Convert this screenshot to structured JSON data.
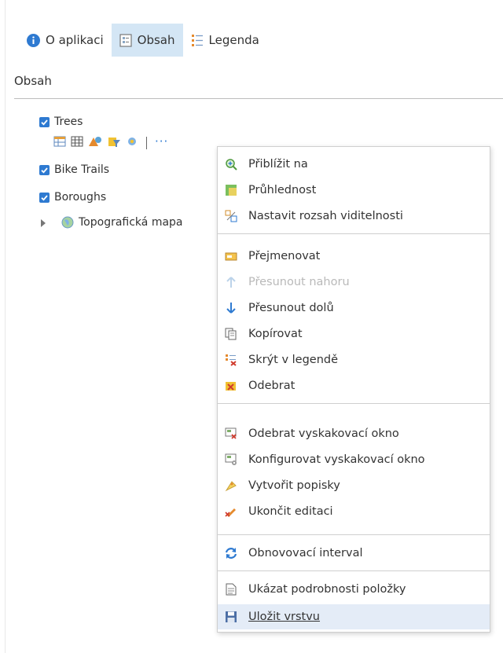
{
  "tabs": [
    {
      "label": "O aplikaci",
      "icon": "info-icon"
    },
    {
      "label": "Obsah",
      "icon": "contents-icon",
      "active": true
    },
    {
      "label": "Legenda",
      "icon": "legend-icon"
    }
  ],
  "section_title": "Obsah",
  "layers": [
    {
      "name": "Trees",
      "checked": true
    },
    {
      "name": "Bike Trails",
      "checked": true
    },
    {
      "name": "Boroughs",
      "checked": true
    },
    {
      "name": "Topografická mapa",
      "icon": "basemap-globe-icon"
    }
  ],
  "layer_tools": [
    "table-icon",
    "attribute-grid-icon",
    "style-icon",
    "filter-icon",
    "analysis-icon",
    "more-options-icon"
  ],
  "layer_tools_more": "···",
  "menu": {
    "items": [
      {
        "label": "Přiblížit na",
        "icon": "zoom-to-icon"
      },
      {
        "label": "Průhlednost",
        "icon": "transparency-icon"
      },
      {
        "label": "Nastavit rozsah viditelnosti",
        "icon": "visibility-range-icon"
      },
      {
        "label": "Přejmenovat",
        "icon": "rename-icon"
      },
      {
        "label": "Přesunout nahoru",
        "icon": "arrow-up-icon",
        "disabled": true
      },
      {
        "label": "Přesunout dolů",
        "icon": "arrow-down-icon"
      },
      {
        "label": "Kopírovat",
        "icon": "copy-icon"
      },
      {
        "label": "Skrýt v legendě",
        "icon": "hide-in-legend-icon"
      },
      {
        "label": "Odebrat",
        "icon": "remove-icon"
      },
      {
        "label": "Odebrat vyskakovací okno",
        "icon": "remove-popup-icon"
      },
      {
        "label": "Konfigurovat vyskakovací okno",
        "icon": "configure-popup-icon"
      },
      {
        "label": "Vytvořit popisky",
        "icon": "create-labels-icon"
      },
      {
        "label": "Ukončit editaci",
        "icon": "stop-editing-icon"
      },
      {
        "label": "Obnovovací interval",
        "icon": "refresh-interval-icon"
      },
      {
        "label": "Ukázat podrobnosti položky",
        "icon": "item-details-icon"
      },
      {
        "label": "Uložit vrstvu",
        "icon": "save-layer-icon",
        "hovered": true
      }
    ]
  },
  "colors": {
    "accent": "#2e7ad1",
    "active_tab": "#d4e6f5",
    "menu_hover": "#e4ecf7"
  }
}
